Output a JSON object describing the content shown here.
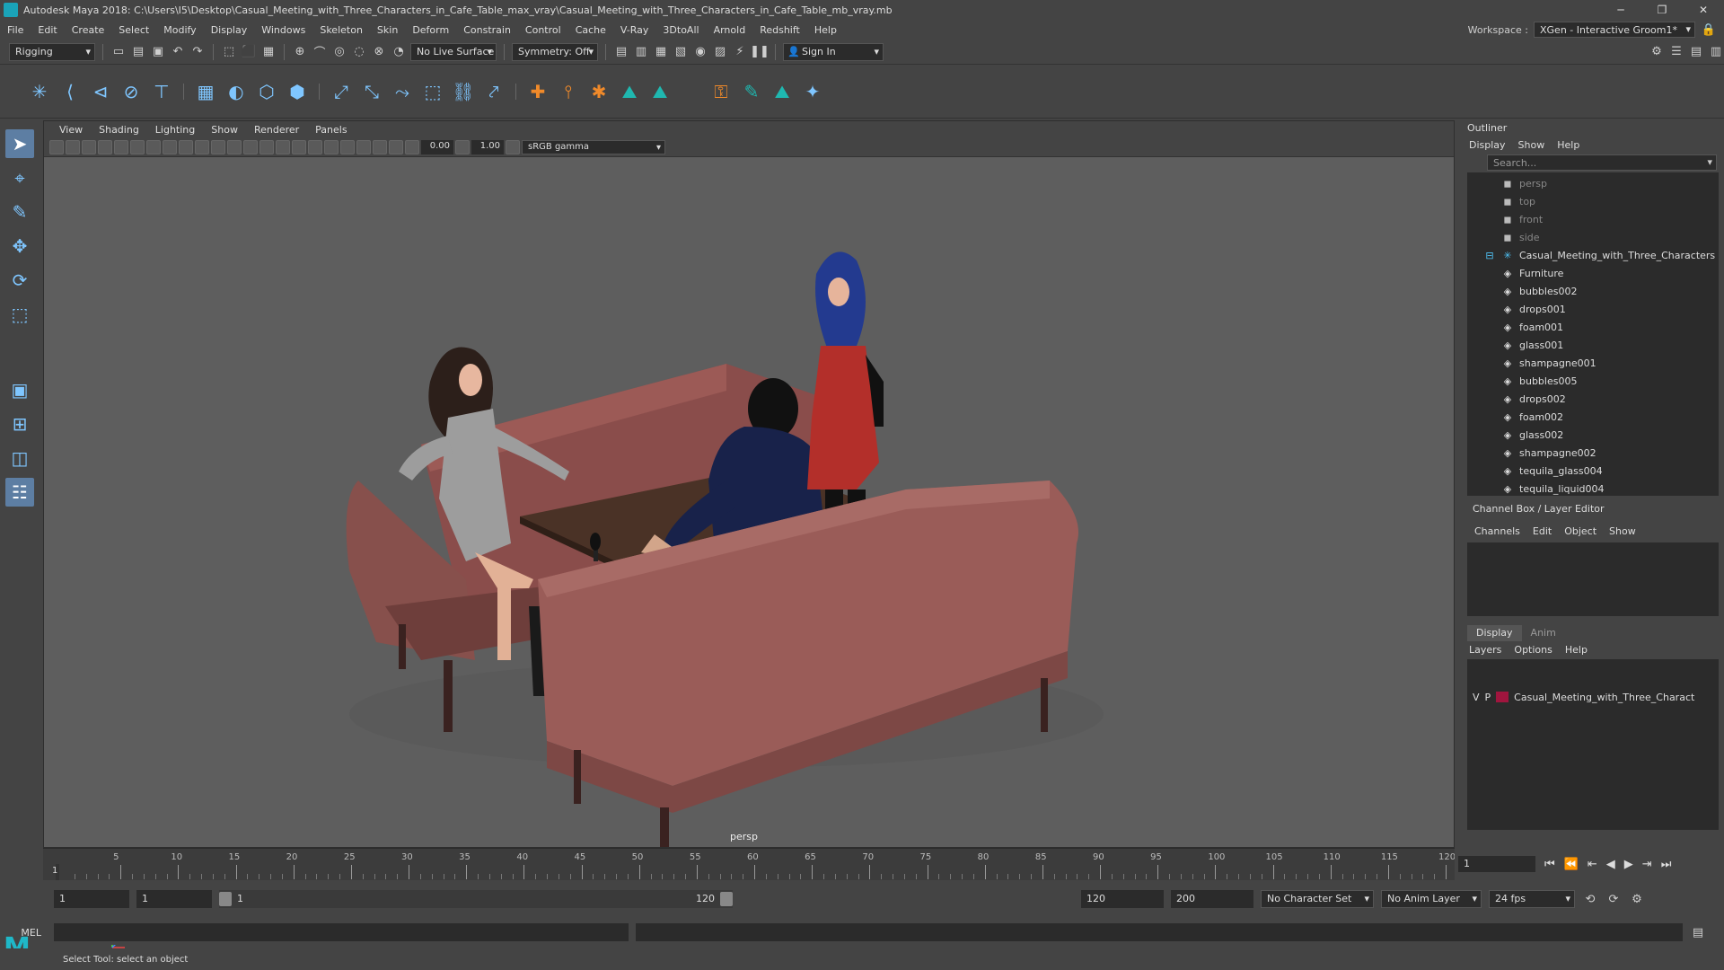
{
  "titlebar": {
    "title": "Autodesk Maya 2018: C:\\Users\\I5\\Desktop\\Casual_Meeting_with_Three_Characters_in_Cafe_Table_max_vray\\Casual_Meeting_with_Three_Characters_in_Cafe_Table_mb_vray.mb",
    "min": "─",
    "max": "❐",
    "close": "✕"
  },
  "menu": {
    "items": [
      "File",
      "Edit",
      "Create",
      "Select",
      "Modify",
      "Display",
      "Windows",
      "Skeleton",
      "Skin",
      "Deform",
      "Constrain",
      "Control",
      "Cache",
      "V-Ray",
      "3DtoAll",
      "Arnold",
      "Redshift",
      "Help"
    ],
    "workspace_label": "Workspace :",
    "workspace_value": "XGen - Interactive Groom1*"
  },
  "status": {
    "mode": "Rigging",
    "live_surface": "No Live Surface",
    "symmetry": "Symmetry: Off",
    "sign_in": "Sign In"
  },
  "viewport": {
    "menus": [
      "View",
      "Shading",
      "Lighting",
      "Show",
      "Renderer",
      "Panels"
    ],
    "exposure": "0.00",
    "gamma": "1.00",
    "colorspace": "sRGB gamma",
    "camera": "persp"
  },
  "outliner": {
    "title": "Outliner",
    "menus": [
      "Display",
      "Show",
      "Help"
    ],
    "search_placeholder": "Search...",
    "cameras": [
      "persp",
      "top",
      "front",
      "side"
    ],
    "group": "Casual_Meeting_with_Three_Characters",
    "children": [
      "Furniture",
      "bubbles002",
      "drops001",
      "foam001",
      "glass001",
      "shampagne001",
      "bubbles005",
      "drops002",
      "foam002",
      "glass002",
      "shampagne002",
      "tequila_glass004",
      "tequila_liquid004"
    ]
  },
  "channelbox": {
    "title": "Channel Box / Layer Editor",
    "menus": [
      "Channels",
      "Edit",
      "Object",
      "Show"
    ]
  },
  "layers": {
    "tabs": [
      "Display",
      "Anim"
    ],
    "menus": [
      "Layers",
      "Options",
      "Help"
    ],
    "row": {
      "v": "V",
      "p": "P",
      "name": "Casual_Meeting_with_Three_Charact"
    }
  },
  "timeline": {
    "labels": [
      "5",
      "10",
      "15",
      "20",
      "25",
      "30",
      "35",
      "40",
      "45",
      "50",
      "55",
      "60",
      "65",
      "70",
      "75",
      "80",
      "85",
      "90",
      "95",
      "100",
      "105",
      "110",
      "115",
      "120"
    ],
    "current": "1",
    "current_frame": "1"
  },
  "range": {
    "start": "1",
    "play_start": "1",
    "slider_start": "1",
    "slider_end": "120",
    "play_end": "120",
    "end": "200",
    "character_set": "No Character Set",
    "anim_layer": "No Anim Layer",
    "fps": "24 fps"
  },
  "cmd": {
    "label": "MEL"
  },
  "help": {
    "text": "Select Tool: select an object"
  },
  "colors": {
    "accent": "#1aa3b8",
    "layer": "#a0153e"
  }
}
